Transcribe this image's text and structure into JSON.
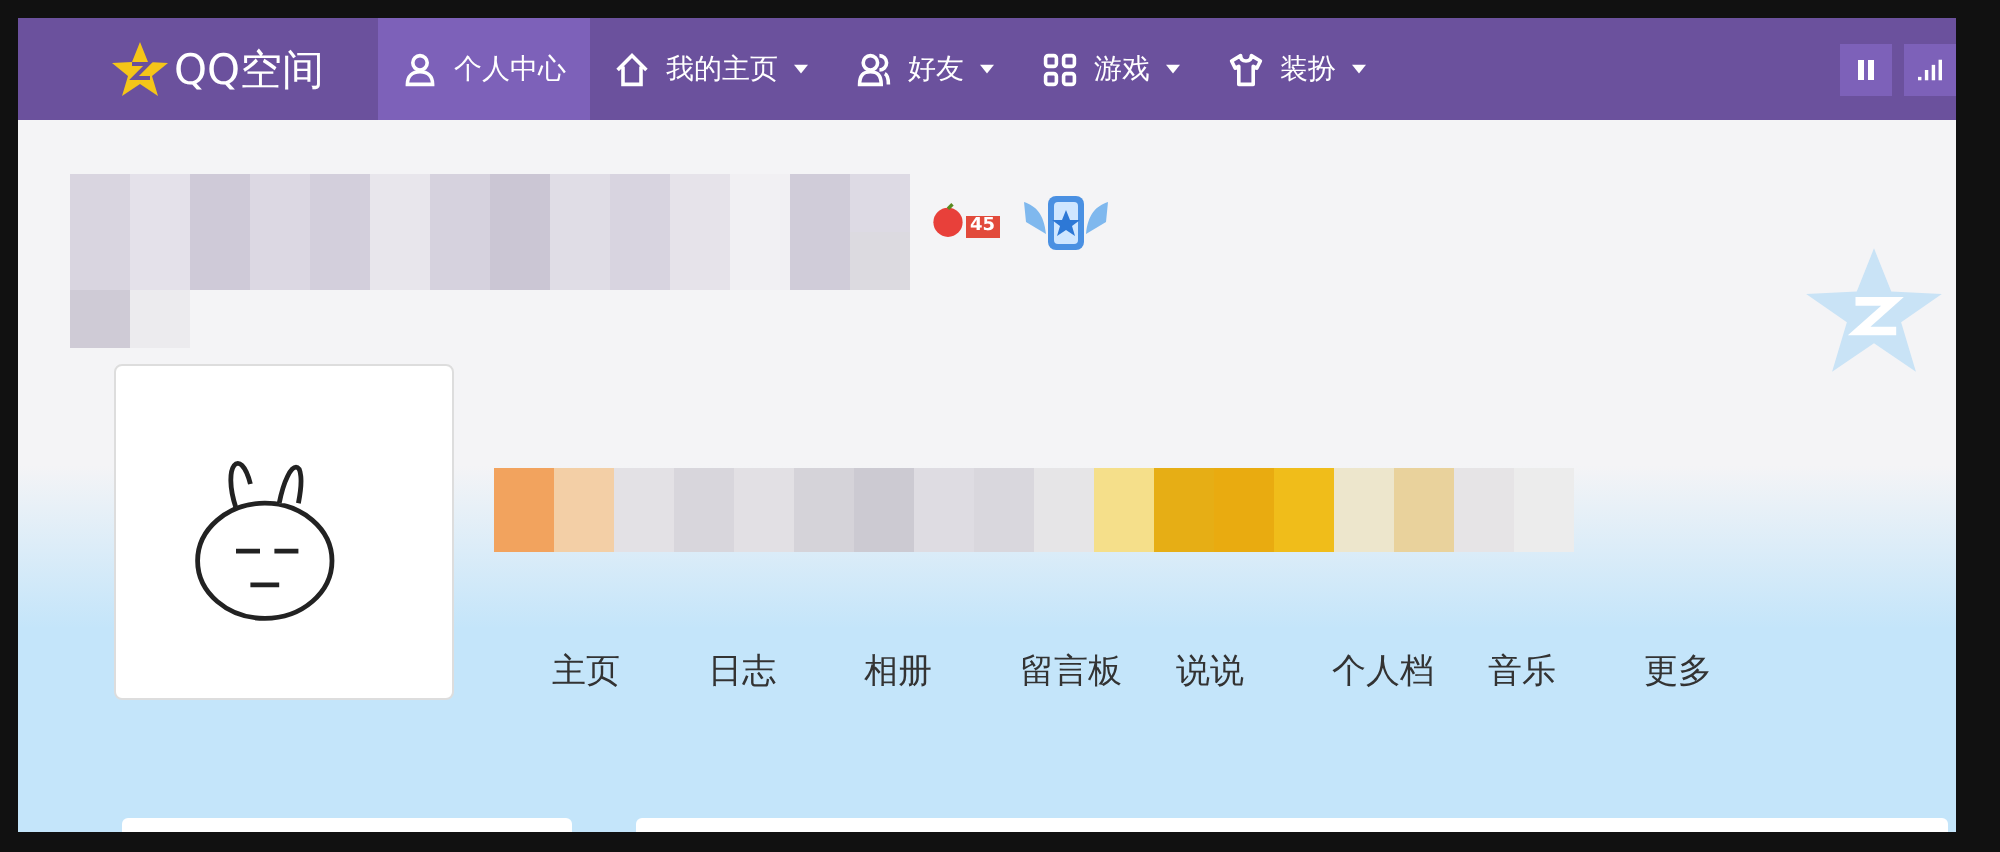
{
  "nav": {
    "logo": "QQ空间",
    "items": [
      {
        "label": "个人中心",
        "kind": "person",
        "caret": false,
        "selected": true
      },
      {
        "label": "我的主页",
        "kind": "home",
        "caret": true,
        "selected": false
      },
      {
        "label": "好友",
        "kind": "friends",
        "caret": true,
        "selected": false
      },
      {
        "label": "游戏",
        "kind": "grid",
        "caret": true,
        "selected": false
      },
      {
        "label": "装扮",
        "kind": "shirt",
        "caret": true,
        "selected": false
      }
    ]
  },
  "profile": {
    "level_badge": "45"
  },
  "profile_tabs": [
    {
      "label": "主页",
      "selected": false
    },
    {
      "label": "日志",
      "selected": false
    },
    {
      "label": "相册",
      "selected": false
    },
    {
      "label": "留言板",
      "selected": false
    },
    {
      "label": "说说",
      "selected": false
    },
    {
      "label": "个人档",
      "selected": false
    },
    {
      "label": "音乐",
      "selected": false
    },
    {
      "label": "更多",
      "selected": false
    }
  ]
}
